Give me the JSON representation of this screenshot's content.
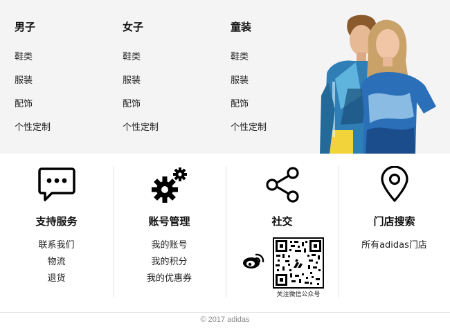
{
  "categories": [
    {
      "title": "男子",
      "items": [
        "鞋类",
        "服装",
        "配饰",
        "个性定制"
      ]
    },
    {
      "title": "女子",
      "items": [
        "鞋类",
        "服装",
        "配饰",
        "个性定制"
      ]
    },
    {
      "title": "童装",
      "items": [
        "鞋类",
        "服装",
        "配饰",
        "个性定制"
      ]
    }
  ],
  "services": {
    "support": {
      "title": "支持服务",
      "icon": "chat-bubble-icon",
      "links": [
        "联系我们",
        "物流",
        "退货"
      ]
    },
    "account": {
      "title": "账号管理",
      "icon": "gears-icon",
      "links": [
        "我的账号",
        "我的积分",
        "我的优惠券"
      ]
    },
    "social": {
      "title": "社交",
      "icon": "share-icon",
      "weibo_icon": "weibo-icon",
      "qr_caption": "关注微信公众号"
    },
    "stores": {
      "title": "门店搜索",
      "icon": "location-pin-icon",
      "links": [
        "所有adidas门店"
      ]
    }
  },
  "footer": {
    "copyright": "© 2017 adidas"
  },
  "colors": {
    "background": "#ffffff",
    "category_background": "#f4f4f4",
    "divider": "#e2e2e2",
    "text": "#000000",
    "muted": "#888888"
  }
}
